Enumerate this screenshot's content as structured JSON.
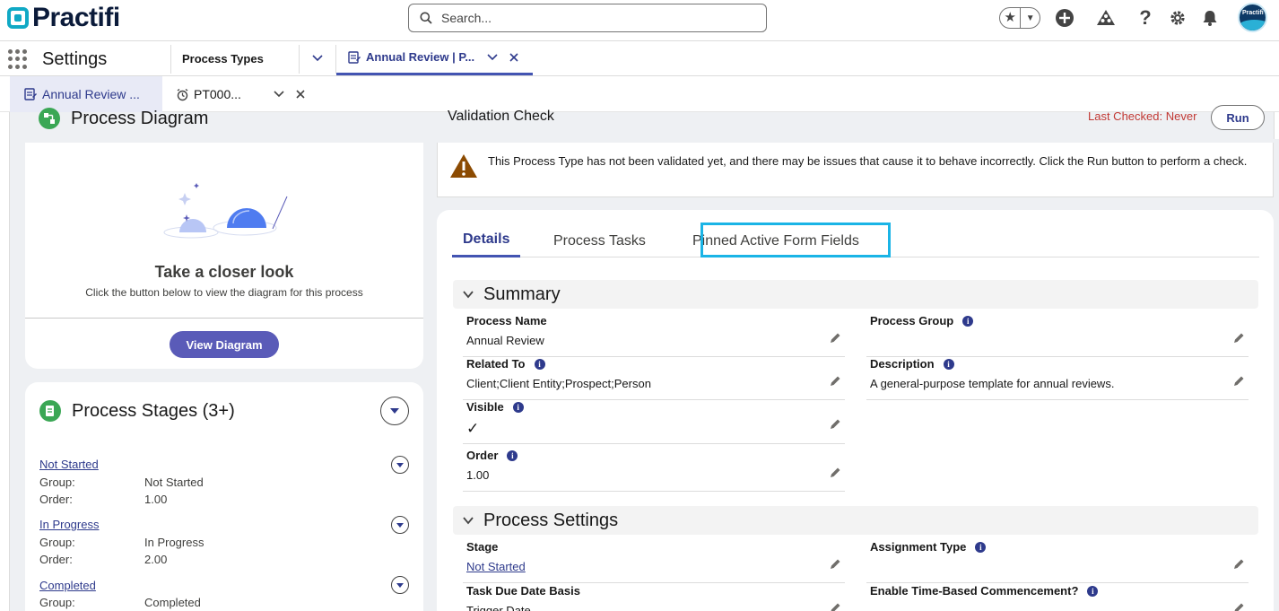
{
  "header": {
    "logo_text": "Practifi",
    "search_placeholder": "Search...",
    "avatar_text": "Practifi"
  },
  "nav": {
    "app_name": "Settings",
    "tabs": [
      {
        "label": "Process Types"
      },
      {
        "label": "Annual Review | P..."
      }
    ]
  },
  "subtabs": [
    {
      "label": "Annual Review ..."
    },
    {
      "label": "PT000..."
    }
  ],
  "process_diagram": {
    "title": "Process Diagram",
    "closer_title": "Take a closer look",
    "closer_sub": "Click the button below to view the diagram for this process",
    "button": "View Diagram"
  },
  "process_stages": {
    "title": "Process Stages (3+)",
    "group_label": "Group:",
    "order_label": "Order:",
    "items": [
      {
        "name": "Not Started",
        "group": "Not Started",
        "order": "1.00"
      },
      {
        "name": "In Progress",
        "group": "In Progress",
        "order": "2.00"
      },
      {
        "name": "Completed",
        "group": "Completed",
        "order": ""
      }
    ]
  },
  "validation": {
    "title": "Validation Check",
    "last_checked": "Last Checked: Never",
    "run_button": "Run",
    "warning": "This Process Type has not been validated yet, and there may be issues that cause it to behave incorrectly. Click the Run button to perform a check."
  },
  "details": {
    "tabs": [
      "Details",
      "Process Tasks",
      "Pinned Active Form Fields"
    ],
    "summary": {
      "title": "Summary",
      "fields": {
        "process_name": {
          "label": "Process Name",
          "value": "Annual Review"
        },
        "process_group": {
          "label": "Process Group",
          "value": ""
        },
        "related_to": {
          "label": "Related To",
          "value": "Client;Client Entity;Prospect;Person"
        },
        "description": {
          "label": "Description",
          "value": "A general-purpose template for annual reviews."
        },
        "visible": {
          "label": "Visible",
          "value": "✓"
        },
        "order": {
          "label": "Order",
          "value": "1.00"
        }
      }
    },
    "process_settings": {
      "title": "Process Settings",
      "fields": {
        "stage": {
          "label": "Stage",
          "value": "Not Started"
        },
        "assignment_type": {
          "label": "Assignment Type",
          "value": ""
        },
        "task_due_date_basis": {
          "label": "Task Due Date Basis",
          "value": "Trigger Date"
        },
        "enable_time_based": {
          "label": "Enable Time-Based Commencement?",
          "value": ""
        }
      }
    }
  },
  "colors": {
    "brand": "#10a9c5",
    "primary": "#5a5bb8",
    "link": "#2e3a8c",
    "error": "#c23934",
    "highlight": "#1ab4e6",
    "success_icon": "#3ba755"
  }
}
